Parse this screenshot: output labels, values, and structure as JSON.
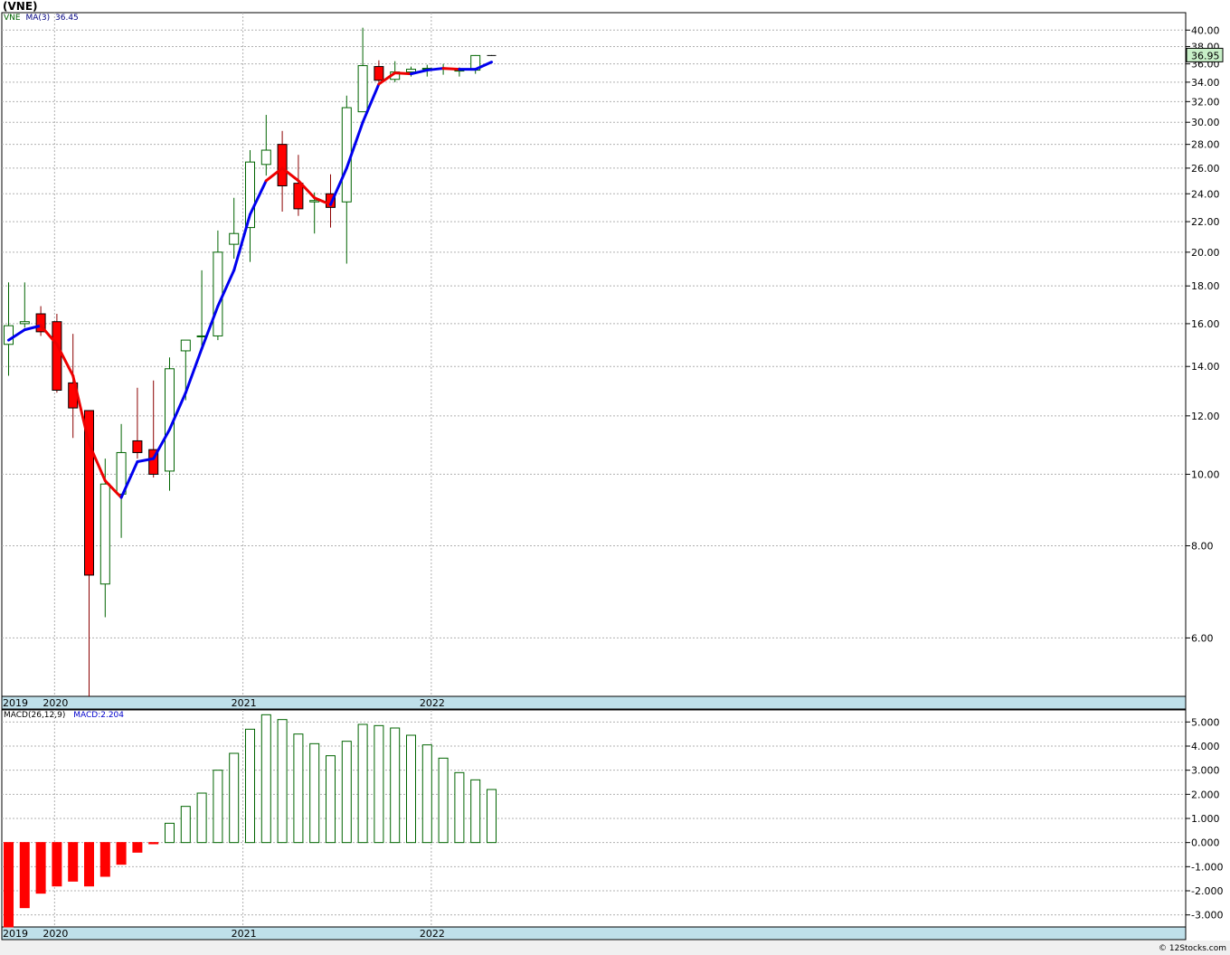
{
  "title": "(VNE)",
  "legend_top": {
    "symbol": "VNE",
    "ma_label": "MA(3)",
    "ma_value": "36.45"
  },
  "legend_bottom": {
    "macd_label": "MACD(26,12,9)",
    "macd_value": "MACD:2.204"
  },
  "last_price_label": "36.95",
  "footer": "© 12Stocks.com",
  "colors": {
    "up": "#006400",
    "down": "#ff0000",
    "ma_up": "#0000ee",
    "ma_down": "#ee0000",
    "axis_band": "#bfe0ea",
    "grid": "#b0b0b0",
    "last_price_bg": "#c8f0c8"
  },
  "chart_data": [
    {
      "type": "candlestick",
      "scale": "log",
      "y_ticks": [
        "6.00",
        "8.00",
        "10.00",
        "12.00",
        "14.00",
        "16.00",
        "18.00",
        "20.00",
        "22.00",
        "24.00",
        "26.00",
        "28.00",
        "30.00",
        "32.00",
        "34.00",
        "36.00",
        "38.00",
        "40.00"
      ],
      "ylim": [
        5.0,
        42.0
      ],
      "year_labels": [
        {
          "label": "2019",
          "index": 0
        },
        {
          "label": "2020",
          "index": 3.3
        },
        {
          "label": "2021",
          "index": 15.0
        },
        {
          "label": "2022",
          "index": 26.7
        }
      ],
      "candles": [
        {
          "o": 15.0,
          "h": 18.2,
          "l": 13.6,
          "c": 15.9
        },
        {
          "o": 16.0,
          "h": 18.2,
          "l": 15.8,
          "c": 16.1
        },
        {
          "o": 16.5,
          "h": 16.9,
          "l": 15.4,
          "c": 15.6
        },
        {
          "o": 16.1,
          "h": 16.5,
          "l": 12.9,
          "c": 13.0
        },
        {
          "o": 13.3,
          "h": 15.5,
          "l": 11.2,
          "c": 12.3
        },
        {
          "o": 12.2,
          "h": 12.2,
          "l": 5.0,
          "c": 7.3
        },
        {
          "o": 7.1,
          "h": 10.5,
          "l": 6.4,
          "c": 9.7
        },
        {
          "o": 9.4,
          "h": 11.7,
          "l": 8.2,
          "c": 10.7
        },
        {
          "o": 11.1,
          "h": 13.1,
          "l": 10.5,
          "c": 10.7
        },
        {
          "o": 10.8,
          "h": 13.4,
          "l": 9.9,
          "c": 10.0
        },
        {
          "o": 10.1,
          "h": 14.4,
          "l": 9.5,
          "c": 13.9
        },
        {
          "o": 14.7,
          "h": 15.2,
          "l": 12.6,
          "c": 15.2
        },
        {
          "o": 15.4,
          "h": 18.9,
          "l": 14.9,
          "c": 15.4
        },
        {
          "o": 15.4,
          "h": 21.4,
          "l": 15.2,
          "c": 20.0
        },
        {
          "o": 20.5,
          "h": 23.7,
          "l": 19.6,
          "c": 21.2
        },
        {
          "o": 21.6,
          "h": 27.5,
          "l": 19.4,
          "c": 26.5
        },
        {
          "o": 26.3,
          "h": 30.7,
          "l": 25.4,
          "c": 27.5
        },
        {
          "o": 28.0,
          "h": 29.2,
          "l": 22.7,
          "c": 24.6
        },
        {
          "o": 24.8,
          "h": 27.1,
          "l": 22.4,
          "c": 22.9
        },
        {
          "o": 23.4,
          "h": 24.1,
          "l": 21.2,
          "c": 23.5
        },
        {
          "o": 24.0,
          "h": 25.5,
          "l": 21.6,
          "c": 23.0
        },
        {
          "o": 23.4,
          "h": 32.6,
          "l": 19.3,
          "c": 31.4
        },
        {
          "o": 31.0,
          "h": 40.3,
          "l": 31.0,
          "c": 35.8
        },
        {
          "o": 35.7,
          "h": 36.4,
          "l": 34.0,
          "c": 34.2
        },
        {
          "o": 34.3,
          "h": 36.3,
          "l": 34.0,
          "c": 35.1
        },
        {
          "o": 35.1,
          "h": 35.7,
          "l": 34.6,
          "c": 35.4
        },
        {
          "o": 35.5,
          "h": 35.9,
          "l": 34.6,
          "c": 35.5
        },
        {
          "o": 35.5,
          "h": 36.0,
          "l": 34.8,
          "c": 35.5
        },
        {
          "o": 35.3,
          "h": 35.6,
          "l": 34.6,
          "c": 35.3
        },
        {
          "o": 35.3,
          "h": 37.0,
          "l": 34.9,
          "c": 36.95
        },
        {
          "o": 36.95,
          "h": 37.0,
          "l": 36.9,
          "c": 36.95
        }
      ],
      "ma3": [
        15.2,
        15.7,
        15.9,
        15.0,
        13.6,
        11.0,
        9.8,
        9.3,
        10.4,
        10.5,
        11.5,
        12.9,
        14.8,
        16.9,
        18.9,
        22.5,
        25.0,
        26.0,
        25.0,
        23.7,
        23.2,
        26.0,
        30.0,
        33.8,
        35.0,
        34.9,
        35.3,
        35.5,
        35.4,
        35.4,
        36.2
      ],
      "ma3_color": [
        "blue",
        "blue",
        "blue",
        "red",
        "red",
        "red",
        "red",
        "red",
        "blue",
        "blue",
        "blue",
        "blue",
        "blue",
        "blue",
        "blue",
        "blue",
        "blue",
        "red",
        "red",
        "red",
        "red",
        "blue",
        "blue",
        "blue",
        "red",
        "red",
        "blue",
        "blue",
        "red",
        "blue",
        "blue"
      ]
    },
    {
      "type": "bar",
      "name": "MACD",
      "y_ticks": [
        "-3.000",
        "-2.000",
        "-1.000",
        "0.000",
        "1.000",
        "2.000",
        "3.000",
        "4.000",
        "5.000"
      ],
      "ylim": [
        -3.5,
        5.5
      ],
      "values": [
        -3.6,
        -2.7,
        -2.1,
        -1.8,
        -1.6,
        -1.8,
        -1.4,
        -0.9,
        -0.4,
        -0.05,
        0.8,
        1.5,
        2.05,
        3.0,
        3.7,
        4.7,
        5.3,
        5.1,
        4.5,
        4.1,
        3.6,
        4.2,
        4.9,
        4.85,
        4.75,
        4.45,
        4.05,
        3.5,
        2.9,
        2.6,
        2.2
      ]
    }
  ]
}
